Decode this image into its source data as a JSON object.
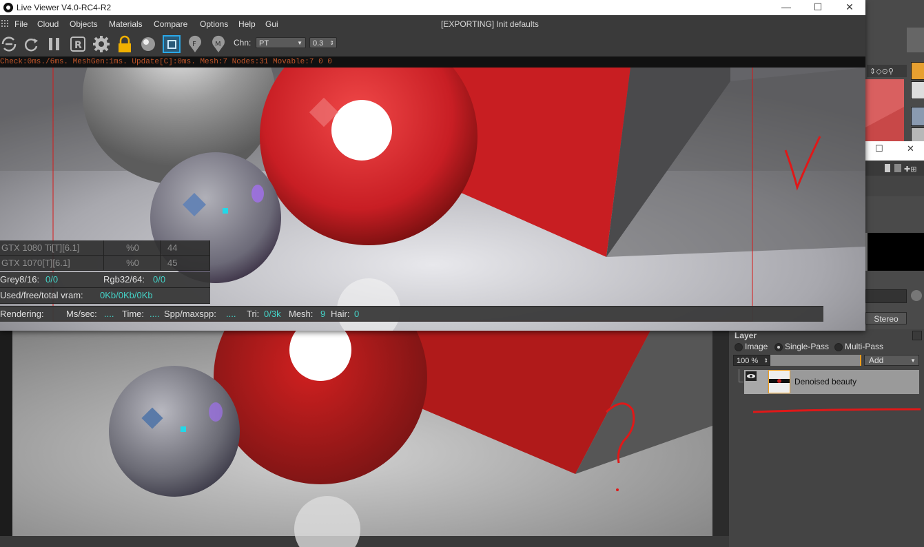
{
  "window": {
    "title": "Live Viewer V4.0-RC4-R2",
    "minimize_glyph": "—",
    "maximize_glyph": "☐",
    "close_glyph": "✕"
  },
  "menu": {
    "items": [
      "File",
      "Cloud",
      "Objects",
      "Materials",
      "Compare",
      "Options",
      "Help",
      "Gui"
    ],
    "center_status": "[EXPORTING] Init defaults"
  },
  "toolbar": {
    "channel_label": "Chn:",
    "channel_value": "PT",
    "amount_value": "0.3",
    "icons": [
      "refresh-settings-icon",
      "reload-icon",
      "pause-icon",
      "r-icon",
      "gear-icon",
      "lock-icon",
      "material-ball-icon",
      "region-icon",
      "focus-pin-icon",
      "material-pin-icon"
    ]
  },
  "statusline": {
    "text": "Check:0ms./6ms. MeshGen:1ms. Update[C]:0ms. Mesh:7 Nodes:31 Movable:7  0 0"
  },
  "gpu_table": {
    "rows": [
      {
        "name": "GTX 1080 Ti[T][6.1]",
        "load": "%0",
        "temp": "44"
      },
      {
        "name": "GTX 1070[T][6.1]",
        "load": "%0",
        "temp": "45"
      }
    ],
    "grey_label": "Grey8/16:",
    "grey_value": "0/0",
    "rgb_label": "Rgb32/64:",
    "rgb_value": "0/0",
    "vram_label": "Used/free/total vram:",
    "vram_value": "0Kb/0Kb/0Kb"
  },
  "render_status": {
    "rendering_label": "Rendering:",
    "mssec_label": "Ms/sec:",
    "mssec_value": "....",
    "time_label": "Time:",
    "time_value": "....",
    "spp_label": "Spp/maxspp:",
    "spp_value": "....",
    "tri_label": "Tri:",
    "tri_value": "0/3k",
    "mesh_label": "Mesh:",
    "mesh_value": "9",
    "hair_label": "Hair:",
    "hair_value": "0"
  },
  "right_panel": {
    "stereo_label": "Stereo",
    "layer_header": "Layer",
    "mode_options": [
      "Image",
      "Single-Pass",
      "Multi-Pass"
    ],
    "selected_mode": "Single-Pass",
    "opacity_value": "100 %",
    "blend_value": "Add",
    "layer_name": "Denoised beauty",
    "restore_glyph": "☐",
    "close_glyph": "✕"
  },
  "colors": {
    "accent_orange": "#f0a020",
    "status_orange": "#c2562a",
    "value_cyan": "#44d4c8",
    "annotation_red": "#e01818"
  }
}
